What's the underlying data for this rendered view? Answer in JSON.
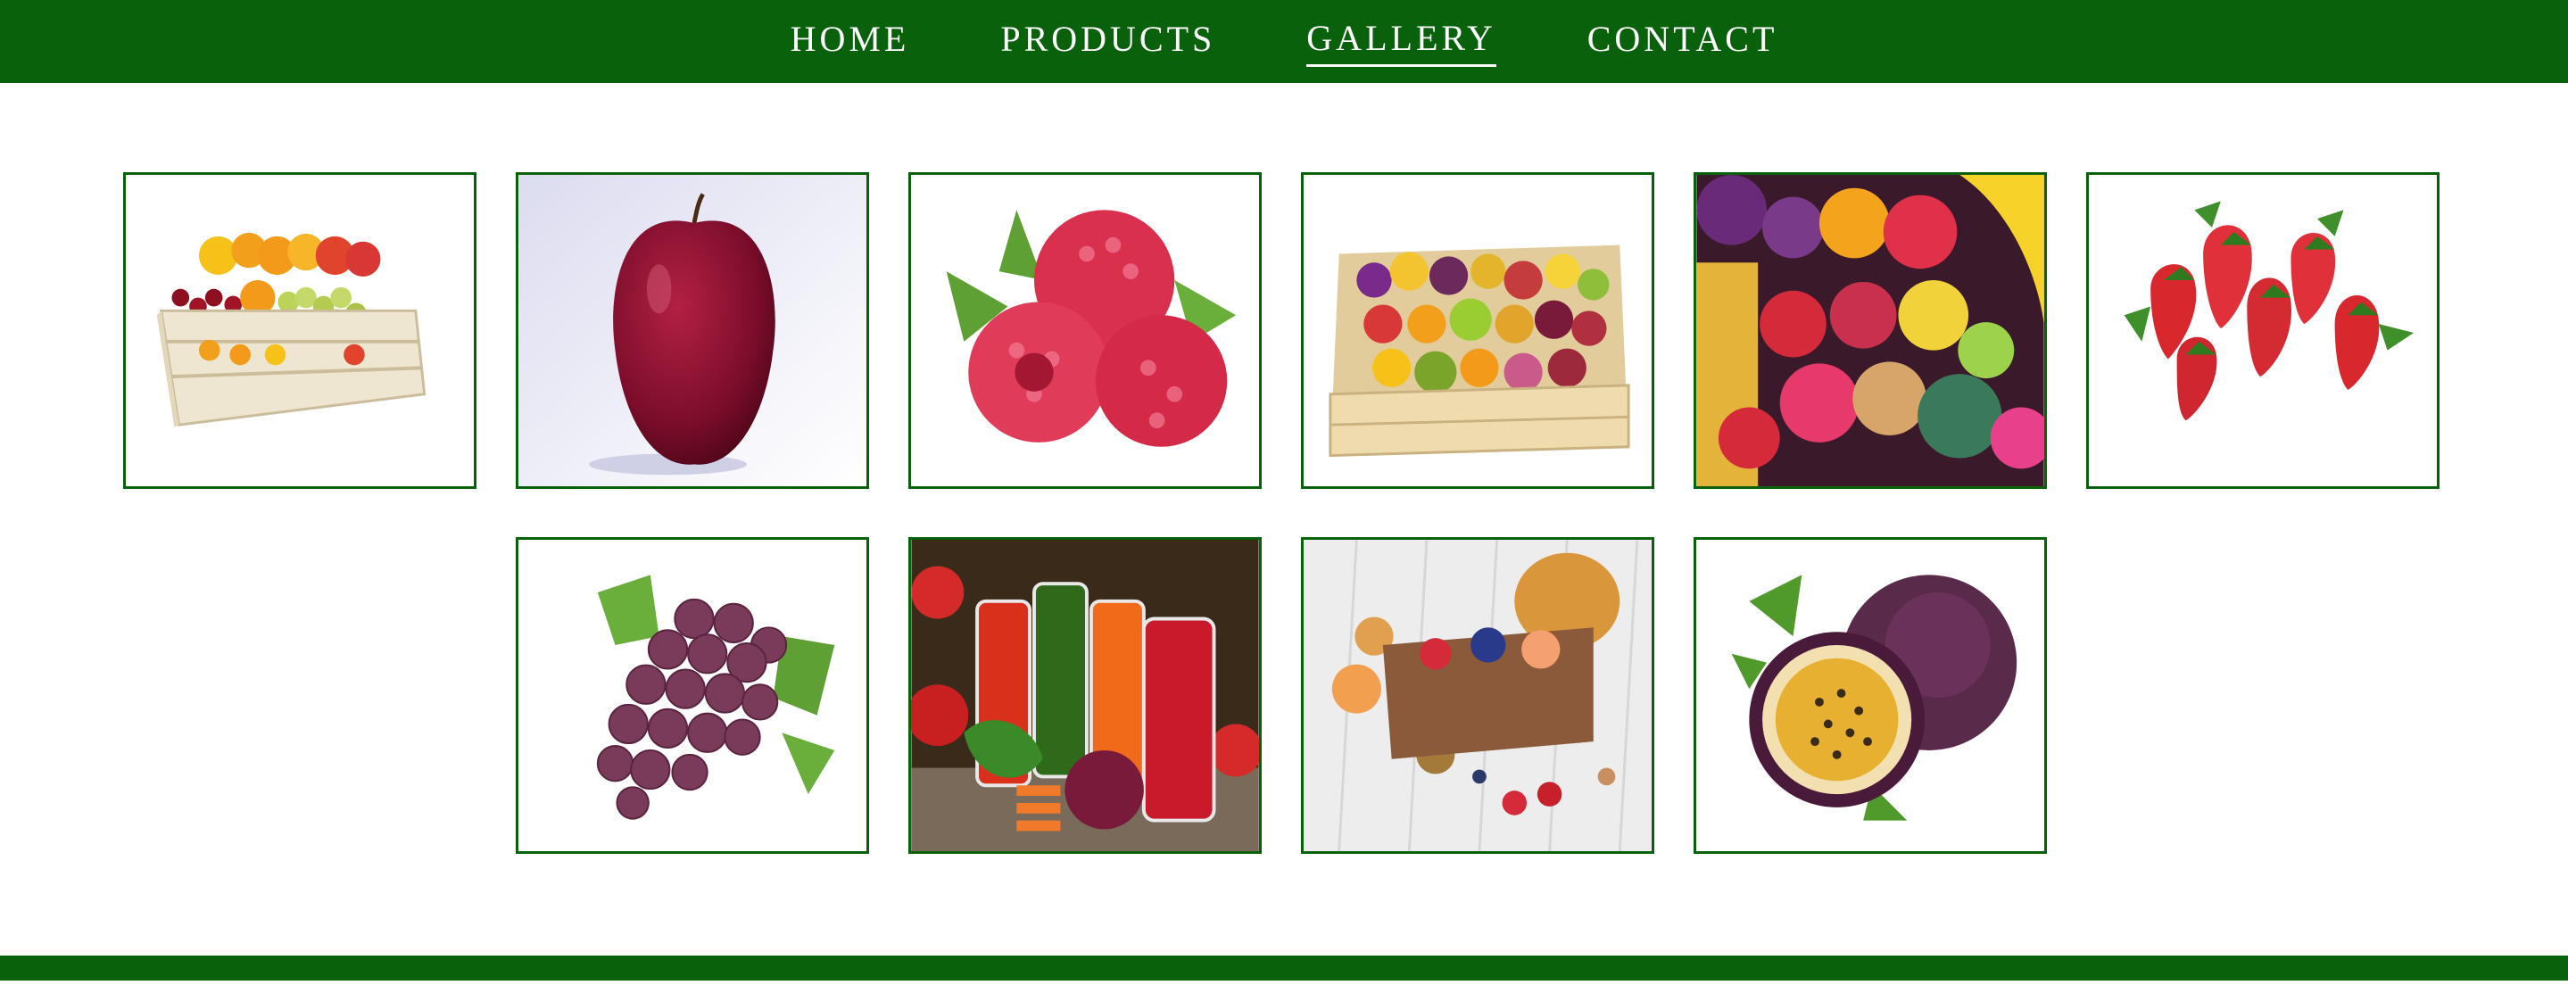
{
  "colors": {
    "brand_green": "#0a610b",
    "nav_text": "#ffffff",
    "background": "#ffffff"
  },
  "nav": {
    "items": [
      {
        "label": "HOME",
        "active": false
      },
      {
        "label": "PRODUCTS",
        "active": false
      },
      {
        "label": "GALLERY",
        "active": true
      },
      {
        "label": "CONTACT",
        "active": false
      }
    ]
  },
  "gallery": {
    "images": [
      {
        "name": "fruit-crate-image"
      },
      {
        "name": "red-apple-image"
      },
      {
        "name": "raspberries-image"
      },
      {
        "name": "wooden-fruit-box-image"
      },
      {
        "name": "assorted-tropical-fruits-image"
      },
      {
        "name": "strawberries-image"
      },
      {
        "name": "red-grapes-image"
      },
      {
        "name": "vegetable-juices-image"
      },
      {
        "name": "fruit-basket-table-image"
      },
      {
        "name": "passion-fruit-image"
      }
    ]
  }
}
